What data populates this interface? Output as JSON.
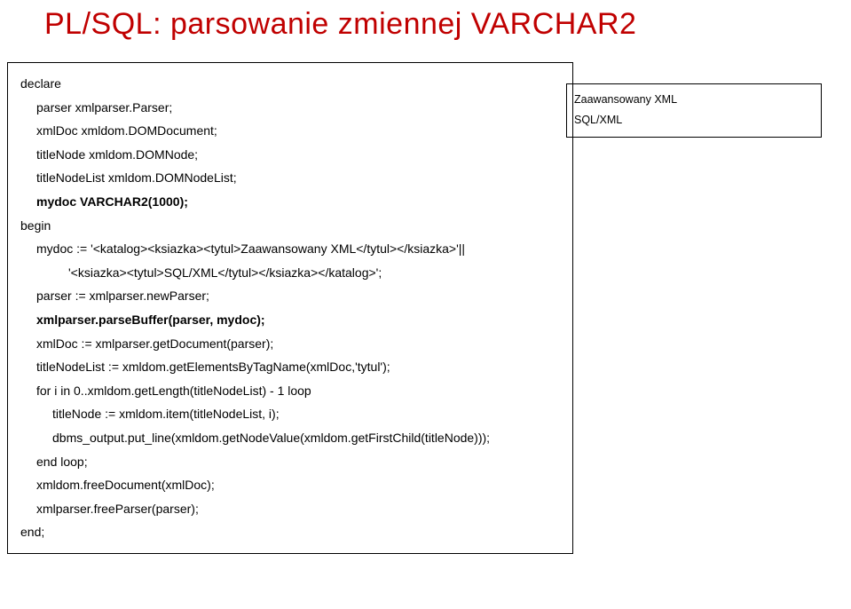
{
  "title": "PL/SQL: parsowanie zmiennej VARCHAR2",
  "code": {
    "l1": "declare",
    "l2": "parser xmlparser.Parser;",
    "l3": "xmlDoc xmldom.DOMDocument;",
    "l4": "titleNode xmldom.DOMNode;",
    "l5": "titleNodeList xmldom.DOMNodeList;",
    "l6": "mydoc VARCHAR2(1000);",
    "l7": "begin",
    "l8": "mydoc := '<katalog><ksiazka><tytul>Zaawansowany XML</tytul></ksiazka>'||",
    "l9": "'<ksiazka><tytul>SQL/XML</tytul></ksiazka></katalog>';",
    "l10": "parser := xmlparser.newParser;",
    "l11": "xmlparser.parseBuffer(parser, mydoc);",
    "l12": "xmlDoc := xmlparser.getDocument(parser);",
    "l13": "titleNodeList := xmldom.getElementsByTagName(xmlDoc,'tytul');",
    "l14": "for i in 0..xmldom.getLength(titleNodeList) - 1 loop",
    "l15": "titleNode := xmldom.item(titleNodeList, i);",
    "l16": "dbms_output.put_line(xmldom.getNodeValue(xmldom.getFirstChild(titleNode)));",
    "l17": "end loop;",
    "l18": "xmldom.freeDocument(xmlDoc);",
    "l19": "xmlparser.freeParser(parser);",
    "l20": "end;"
  },
  "side": {
    "l1": "Zaawansowany XML",
    "l2": "SQL/XML"
  }
}
